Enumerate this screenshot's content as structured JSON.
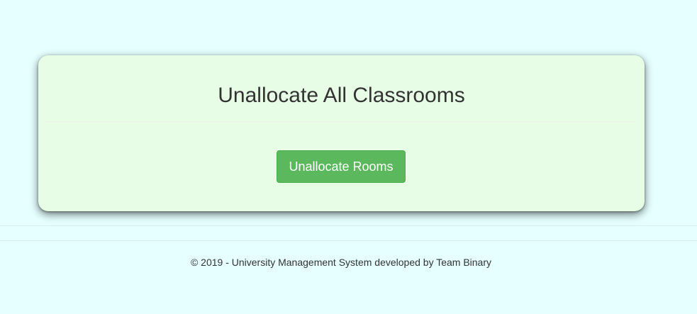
{
  "card": {
    "title": "Unallocate All Classrooms",
    "button_label": "Unallocate Rooms"
  },
  "footer": {
    "text": "© 2019 - University Management System developed by Team Binary"
  },
  "colors": {
    "page_background": "#e6ffff",
    "card_background": "#e7fde5",
    "button_success": "#5cb85c"
  }
}
